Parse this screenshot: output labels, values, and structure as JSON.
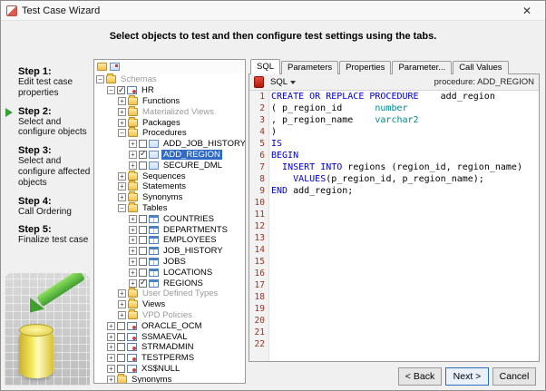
{
  "window": {
    "title": "Test Case Wizard",
    "close_glyph": "✕"
  },
  "heading": "Select objects to test and then configure test settings using the tabs.",
  "colors": {
    "selection_bg": "#316ac5",
    "selection_fg": "#ffffff",
    "active_step_arrow": "#3aa03a",
    "keyword": "#0000cc",
    "datatype": "#008b8b",
    "line_number": "#993322"
  },
  "steps": [
    {
      "label": "Step 1:",
      "desc": "Edit test case properties",
      "active": false
    },
    {
      "label": "Step 2:",
      "desc": "Select and configure objects",
      "active": true
    },
    {
      "label": "Step 3:",
      "desc": "Select and configure affected objects",
      "active": false
    },
    {
      "label": "Step 4:",
      "desc": "Call Ordering",
      "active": false
    },
    {
      "label": "Step 5:",
      "desc": "Finalize test case",
      "active": false
    }
  ],
  "tree": {
    "items": [
      {
        "depth": 0,
        "exp": "open",
        "icon": "folders",
        "label": "Schemas",
        "gray": true
      },
      {
        "depth": 1,
        "exp": "open",
        "check": "checked",
        "icon": "schema",
        "label": "HR"
      },
      {
        "depth": 2,
        "exp": "closed",
        "icon": "folder",
        "label": "Functions"
      },
      {
        "depth": 2,
        "exp": "closed",
        "icon": "folder",
        "label": "Materialized Views",
        "gray": true
      },
      {
        "depth": 2,
        "exp": "closed",
        "icon": "folder",
        "label": "Packages"
      },
      {
        "depth": 2,
        "exp": "open",
        "icon": "folder",
        "label": "Procedures"
      },
      {
        "depth": 3,
        "exp": "closed",
        "check": "unchecked",
        "icon": "proc",
        "label": "ADD_JOB_HISTORY"
      },
      {
        "depth": 3,
        "exp": "closed",
        "check": "checked",
        "icon": "proc",
        "label": "ADD_REGION",
        "selected": true
      },
      {
        "depth": 3,
        "exp": "closed",
        "check": "unchecked",
        "icon": "proc",
        "label": "SECURE_DML"
      },
      {
        "depth": 2,
        "exp": "closed",
        "icon": "folder",
        "label": "Sequences"
      },
      {
        "depth": 2,
        "exp": "closed",
        "icon": "folder",
        "label": "Statements"
      },
      {
        "depth": 2,
        "exp": "closed",
        "icon": "folder",
        "label": "Synonyms"
      },
      {
        "depth": 2,
        "exp": "open",
        "icon": "folder",
        "label": "Tables"
      },
      {
        "depth": 3,
        "exp": "closed",
        "check": "unchecked",
        "icon": "table",
        "label": "COUNTRIES"
      },
      {
        "depth": 3,
        "exp": "closed",
        "check": "unchecked",
        "icon": "table",
        "label": "DEPARTMENTS"
      },
      {
        "depth": 3,
        "exp": "closed",
        "check": "unchecked",
        "icon": "table",
        "label": "EMPLOYEES"
      },
      {
        "depth": 3,
        "exp": "closed",
        "check": "unchecked",
        "icon": "table",
        "label": "JOB_HISTORY"
      },
      {
        "depth": 3,
        "exp": "closed",
        "check": "unchecked",
        "icon": "table",
        "label": "JOBS"
      },
      {
        "depth": 3,
        "exp": "closed",
        "check": "unchecked",
        "icon": "table",
        "label": "LOCATIONS"
      },
      {
        "depth": 3,
        "exp": "closed",
        "check": "checked",
        "icon": "table",
        "label": "REGIONS"
      },
      {
        "depth": 2,
        "exp": "closed",
        "icon": "folder",
        "label": "User Defined Types",
        "gray": true
      },
      {
        "depth": 2,
        "exp": "closed",
        "icon": "folder",
        "label": "Views"
      },
      {
        "depth": 2,
        "exp": "closed",
        "icon": "folder",
        "label": "VPD Policies",
        "gray": true
      },
      {
        "depth": 1,
        "exp": "closed",
        "check": "unchecked",
        "icon": "schema",
        "label": "ORACLE_OCM"
      },
      {
        "depth": 1,
        "exp": "closed",
        "check": "unchecked",
        "icon": "schema",
        "label": "SSMAEVAL"
      },
      {
        "depth": 1,
        "exp": "closed",
        "check": "unchecked",
        "icon": "schema",
        "label": "STRMADMIN"
      },
      {
        "depth": 1,
        "exp": "closed",
        "check": "unchecked",
        "icon": "schema",
        "label": "TESTPERMS"
      },
      {
        "depth": 1,
        "exp": "closed",
        "check": "unchecked",
        "icon": "schema",
        "label": "XS$NULL"
      },
      {
        "depth": 1,
        "exp": "closed",
        "icon": "folder",
        "label": "Synonyms"
      }
    ]
  },
  "tabs": [
    {
      "label": "SQL",
      "active": true
    },
    {
      "label": "Parameters",
      "active": false
    },
    {
      "label": "Properties",
      "active": false
    },
    {
      "label": "Parameter...",
      "active": false
    },
    {
      "label": "Call Values",
      "active": false
    }
  ],
  "editor": {
    "mode_label": "SQL",
    "context_label": "procedure: ADD_REGION",
    "total_lines": 22,
    "lines": [
      [
        [
          "kw",
          "CREATE OR REPLACE PROCEDURE"
        ],
        [
          "pl",
          "    add_region"
        ]
      ],
      [
        [
          "pl",
          "( p_region_id      "
        ],
        [
          "ty",
          "number"
        ]
      ],
      [
        [
          "pl",
          ", p_region_name    "
        ],
        [
          "ty",
          "varchar2"
        ]
      ],
      [
        [
          "pl",
          ")"
        ]
      ],
      [
        [
          "kw",
          "IS"
        ]
      ],
      [
        [
          "kw",
          "BEGIN"
        ]
      ],
      [
        [
          "pl",
          "  "
        ],
        [
          "kw",
          "INSERT INTO"
        ],
        [
          "pl",
          " regions (region_id, region_name)"
        ]
      ],
      [
        [
          "pl",
          "    "
        ],
        [
          "kw",
          "VALUES"
        ],
        [
          "pl",
          "(p_region_id, p_region_name);"
        ]
      ],
      [
        [
          "kw",
          "END"
        ],
        [
          "pl",
          " add_region;"
        ]
      ]
    ]
  },
  "buttons": {
    "back": "< Back",
    "next": "Next >",
    "cancel": "Cancel"
  }
}
